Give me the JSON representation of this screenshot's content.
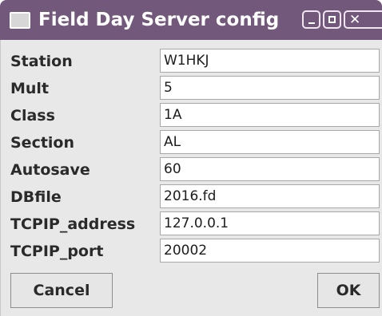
{
  "window": {
    "title": "Field Day Server config",
    "icon": "window-icon",
    "controls": {
      "minimize": "minimize-icon",
      "maximize": "maximize-icon",
      "close": "close-icon"
    },
    "colors": {
      "titlebar": "#72587a",
      "content_background": "#e8e8e8"
    }
  },
  "form": {
    "fields": [
      {
        "label": "Station",
        "value": "W1HKJ"
      },
      {
        "label": "Mult",
        "value": "5"
      },
      {
        "label": "Class",
        "value": "1A"
      },
      {
        "label": "Section",
        "value": "AL"
      },
      {
        "label": "Autosave",
        "value": "60"
      },
      {
        "label": "DBfile",
        "value": "2016.fd"
      },
      {
        "label": "TCPIP_address",
        "value": "127.0.0.1"
      },
      {
        "label": "TCPIP_port",
        "value": "20002"
      }
    ]
  },
  "buttons": {
    "cancel_label": "Cancel",
    "ok_label": "OK"
  }
}
